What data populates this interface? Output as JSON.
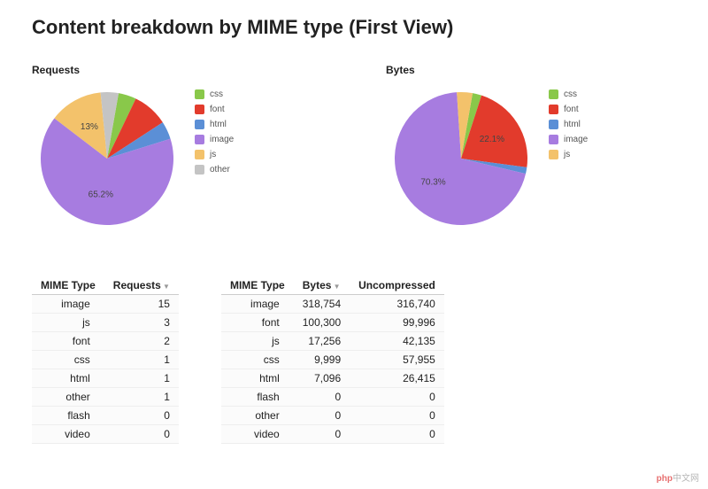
{
  "title": "Content breakdown by MIME type (First View)",
  "colors": {
    "css": "#89c84a",
    "font": "#e23b2c",
    "html": "#5b8fd6",
    "image": "#a77ce0",
    "js": "#f3c26b",
    "other": "#c4c4c4"
  },
  "legend_order": [
    "css",
    "font",
    "html",
    "image",
    "js",
    "other"
  ],
  "chart_data": [
    {
      "type": "pie",
      "title": "Requests",
      "series": [
        {
          "name": "css",
          "value": 1
        },
        {
          "name": "font",
          "value": 2
        },
        {
          "name": "html",
          "value": 1
        },
        {
          "name": "image",
          "value": 15
        },
        {
          "name": "js",
          "value": 3
        },
        {
          "name": "other",
          "value": 1
        }
      ],
      "labels": {
        "image": "65.2%",
        "js": "13%"
      }
    },
    {
      "type": "pie",
      "title": "Bytes",
      "series": [
        {
          "name": "css",
          "value": 9999
        },
        {
          "name": "font",
          "value": 100300
        },
        {
          "name": "html",
          "value": 7096
        },
        {
          "name": "image",
          "value": 318754
        },
        {
          "name": "js",
          "value": 17256
        }
      ],
      "labels": {
        "image": "70.3%",
        "font": "22.1%"
      }
    }
  ],
  "tables": {
    "requests": {
      "columns": [
        "MIME Type",
        "Requests"
      ],
      "rows": [
        {
          "type": "image",
          "requests": 15
        },
        {
          "type": "js",
          "requests": 3
        },
        {
          "type": "font",
          "requests": 2
        },
        {
          "type": "css",
          "requests": 1
        },
        {
          "type": "html",
          "requests": 1
        },
        {
          "type": "other",
          "requests": 1
        },
        {
          "type": "flash",
          "requests": 0
        },
        {
          "type": "video",
          "requests": 0
        }
      ]
    },
    "bytes": {
      "columns": [
        "MIME Type",
        "Bytes",
        "Uncompressed"
      ],
      "rows": [
        {
          "type": "image",
          "bytes": 318754,
          "uncompressed": 316740
        },
        {
          "type": "font",
          "bytes": 100300,
          "uncompressed": 99996
        },
        {
          "type": "js",
          "bytes": 17256,
          "uncompressed": 42135
        },
        {
          "type": "css",
          "bytes": 9999,
          "uncompressed": 57955
        },
        {
          "type": "html",
          "bytes": 7096,
          "uncompressed": 26415
        },
        {
          "type": "flash",
          "bytes": 0,
          "uncompressed": 0
        },
        {
          "type": "other",
          "bytes": 0,
          "uncompressed": 0
        },
        {
          "type": "video",
          "bytes": 0,
          "uncompressed": 0
        }
      ]
    }
  },
  "watermark": {
    "brand": "php",
    "suffix": "中文网"
  }
}
